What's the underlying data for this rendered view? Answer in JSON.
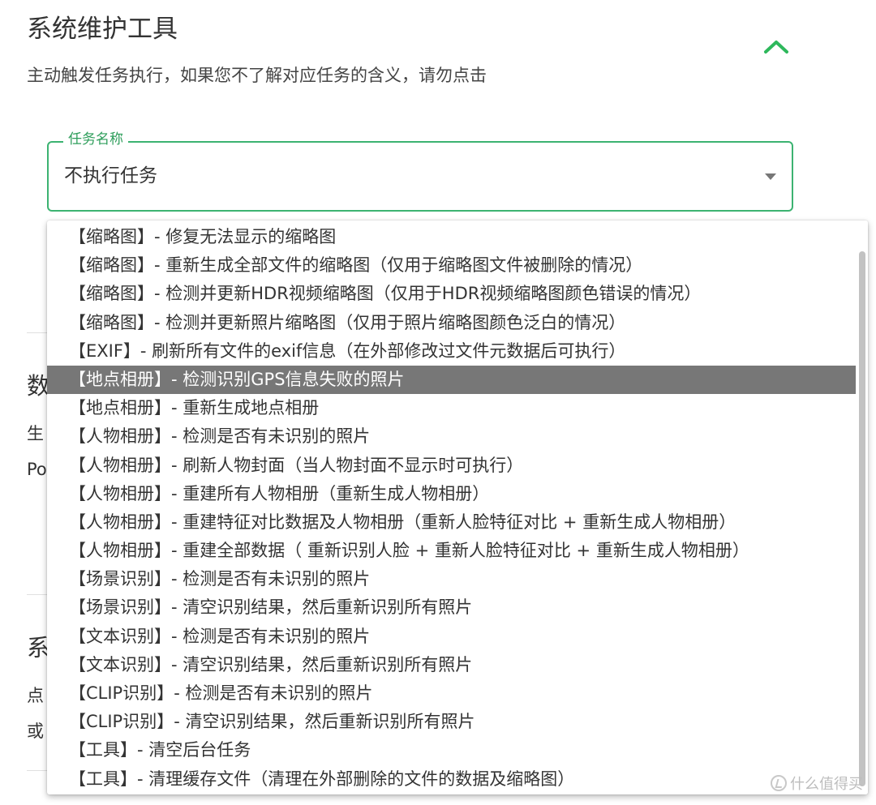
{
  "section": {
    "title": "系统维护工具",
    "description": "主动触发任务执行，如果您不了解对应任务的含义，请勿点击"
  },
  "task_select": {
    "label": "任务名称",
    "value": "不执行任务"
  },
  "background": {
    "heading_1": "数",
    "line_1": "生",
    "line_2": "Po",
    "heading_2": "系",
    "line_3": "点",
    "line_4": "或"
  },
  "menu": {
    "items": [
      "【缩略图】- 修复无法显示的缩略图",
      "【缩略图】- 重新生成全部文件的缩略图（仅用于缩略图文件被删除的情况）",
      "【缩略图】- 检测并更新HDR视频缩略图（仅用于HDR视频缩略图颜色错误的情况）",
      "【缩略图】- 检测并更新照片缩略图（仅用于照片缩略图颜色泛白的情况）",
      "【EXIF】- 刷新所有文件的exif信息（在外部修改过文件元数据后可执行）",
      "【地点相册】- 检测识别GPS信息失败的照片",
      "【地点相册】- 重新生成地点相册",
      "【人物相册】- 检测是否有未识别的照片",
      "【人物相册】- 刷新人物封面（当人物封面不显示时可执行）",
      "【人物相册】- 重建所有人物相册（重新生成人物相册）",
      "【人物相册】- 重建特征对比数据及人物相册（重新人脸特征对比 + 重新生成人物相册）",
      "【人物相册】- 重建全部数据（ 重新识别人脸 + 重新人脸特征对比 + 重新生成人物相册）",
      "【场景识别】- 检测是否有未识别的照片",
      "【场景识别】- 清空识别结果，然后重新识别所有照片",
      "【文本识别】- 检测是否有未识别的照片",
      "【文本识别】- 清空识别结果，然后重新识别所有照片",
      "【CLIP识别】- 检测是否有未识别的照片",
      "【CLIP识别】- 清空识别结果，然后重新识别所有照片",
      "【工具】- 清空后台任务",
      "【工具】- 清理缓存文件（清理在外部删除的文件的数据及缩略图）"
    ]
  },
  "watermark": "值 什么值得买",
  "colors": {
    "accent": "#3cb371",
    "selected_bg": "#777777",
    "scrollbar": "#c2c2c2"
  }
}
